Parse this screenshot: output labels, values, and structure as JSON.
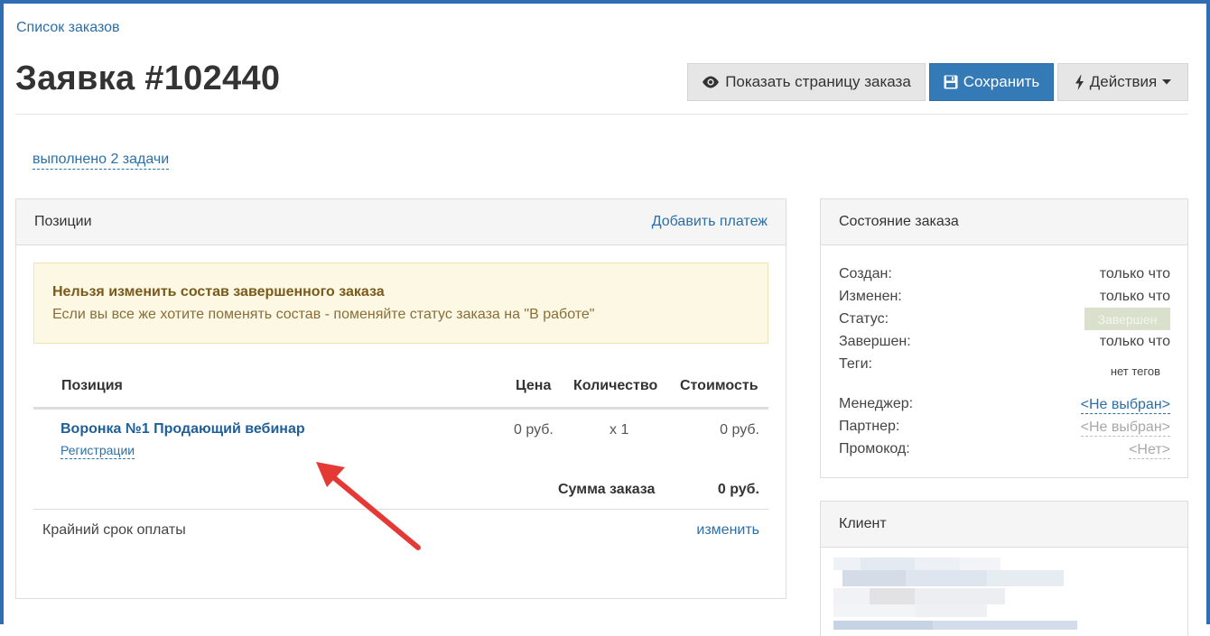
{
  "breadcrumb": "Список заказов",
  "title": "Заявка #102440",
  "toolbar": {
    "show_page": "Показать страницу заказа",
    "save": "Сохранить",
    "actions": "Действия"
  },
  "tasks_link": "выполнено 2 задачи",
  "positions_panel": {
    "title": "Позиции",
    "add_payment": "Добавить платеж",
    "warning": {
      "title": "Нельзя изменить состав завершенного заказа",
      "text": "Если вы все же хотите поменять состав - поменяйте статус заказа на \"В работе\""
    },
    "columns": [
      "Позиция",
      "Цена",
      "Количество",
      "Стоимость"
    ],
    "items": [
      {
        "name": "Воронка №1 Продающий вебинар",
        "sub": "Регистрации",
        "price": "0 руб.",
        "qty": "x 1",
        "cost": "0 руб."
      }
    ],
    "total_label": "Сумма заказа",
    "total_value": "0 руб.",
    "deadline_label": "Крайний срок оплаты",
    "edit": "изменить"
  },
  "status_panel": {
    "title": "Состояние заказа",
    "created_label": "Создан:",
    "created_value": "только что",
    "changed_label": "Изменен:",
    "changed_value": "только что",
    "status_label": "Статус:",
    "status_value": "Завершен",
    "completed_label": "Завершен:",
    "completed_value": "только что",
    "tags_label": "Теги:",
    "tags_value": "нет тегов",
    "manager_label": "Менеджер:",
    "manager_value": "<Не выбран>",
    "partner_label": "Партнер:",
    "partner_value": "<Не выбран>",
    "promo_label": "Промокод:",
    "promo_value": "<Нет>"
  },
  "client_panel": {
    "title": "Клиент"
  },
  "colors": {
    "frame": "#2f6db5",
    "link": "#2a6fa8",
    "primary": "#337ab7",
    "warning_bg": "#fcf8e3",
    "arrow": "#e53935"
  },
  "icons": [
    "eye-icon",
    "save-icon",
    "bolt-icon",
    "caret-down-icon",
    "arrow-annotation"
  ]
}
